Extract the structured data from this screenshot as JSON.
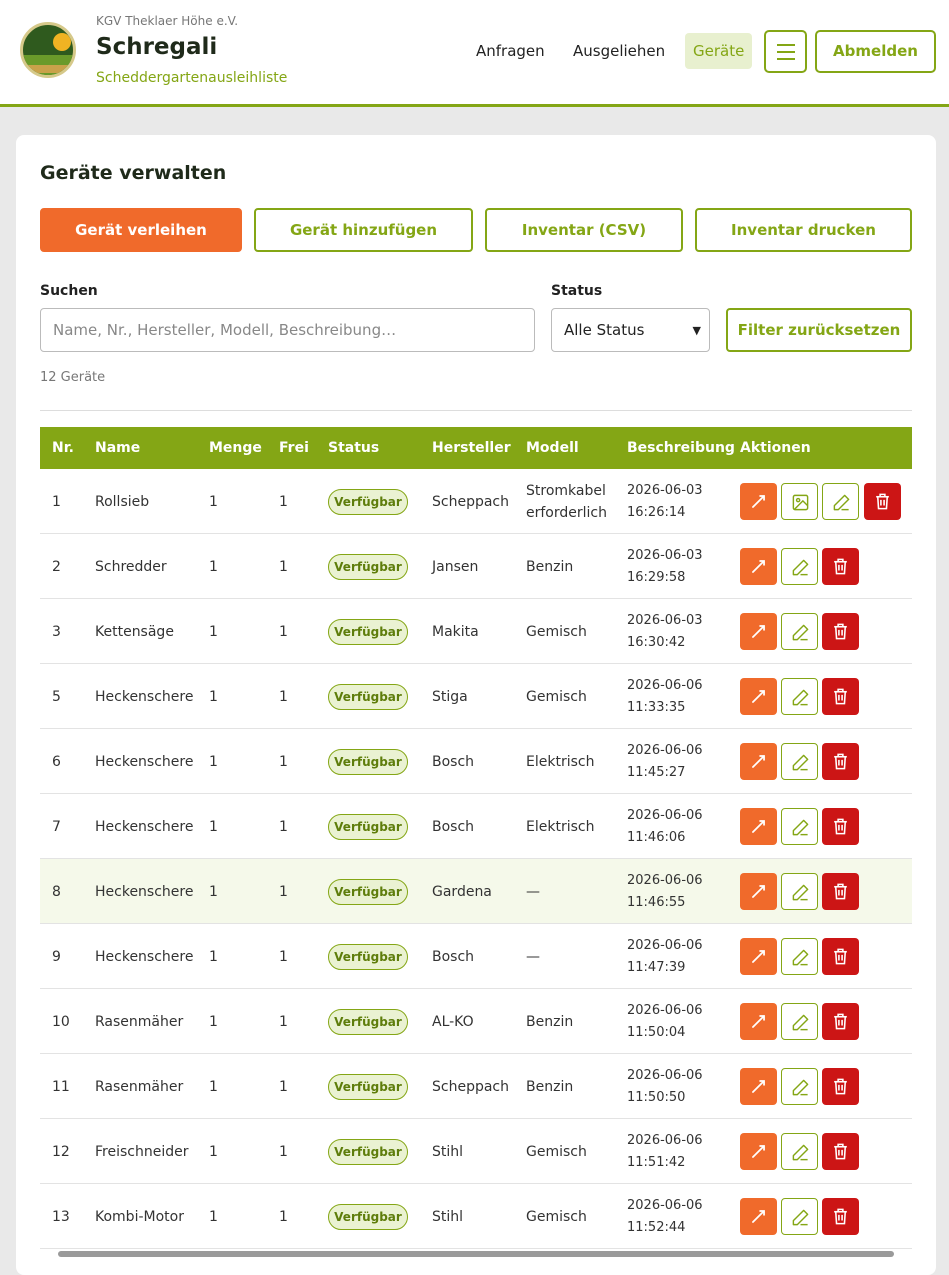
{
  "header": {
    "org": "KGV Theklaer Höhe e.V.",
    "title": "Schregali",
    "subtitle": "Scheddergartenausleihliste",
    "nav": [
      {
        "label": "Anfragen"
      },
      {
        "label": "Ausgeliehen"
      },
      {
        "label": "Geräte",
        "active": true
      }
    ],
    "logout_label": "Abmelden",
    "menu_icon": "hamburger-icon"
  },
  "main": {
    "title": "Geräte verwalten",
    "buttons": {
      "lend": "Gerät verleihen",
      "add": "Gerät hinzufügen",
      "csv": "Inventar (CSV)",
      "print": "Inventar drucken"
    },
    "search": {
      "label": "Suchen",
      "placeholder": "Name, Nr., Hersteller, Modell, Beschreibung…",
      "value": ""
    },
    "status_filter": {
      "label": "Status",
      "selected": "Alle Status"
    },
    "reset_label": "Filter zurücksetzen",
    "count": "12 Geräte"
  },
  "table": {
    "columns": [
      "Nr.",
      "Name",
      "Menge",
      "Frei",
      "Status",
      "Hersteller",
      "Modell",
      "Beschreibung",
      "Aktionen"
    ],
    "rows": [
      {
        "nr": "1",
        "name": "Rollsieb",
        "menge": "1",
        "frei": "1",
        "status": "Verfügbar",
        "hersteller": "Scheppach",
        "modell": "Stromkabel erforderlich",
        "date": "2026-06-03",
        "time": "16:26:14",
        "has_image": true
      },
      {
        "nr": "2",
        "name": "Schredder",
        "menge": "1",
        "frei": "1",
        "status": "Verfügbar",
        "hersteller": "Jansen",
        "modell": "Benzin",
        "date": "2026-06-03",
        "time": "16:29:58"
      },
      {
        "nr": "3",
        "name": "Kettensäge",
        "menge": "1",
        "frei": "1",
        "status": "Verfügbar",
        "hersteller": "Makita",
        "modell": "Gemisch",
        "date": "2026-06-03",
        "time": "16:30:42"
      },
      {
        "nr": "5",
        "name": "Heckenschere",
        "menge": "1",
        "frei": "1",
        "status": "Verfügbar",
        "hersteller": "Stiga",
        "modell": "Gemisch",
        "date": "2026-06-06",
        "time": "11:33:35"
      },
      {
        "nr": "6",
        "name": "Heckenschere",
        "menge": "1",
        "frei": "1",
        "status": "Verfügbar",
        "hersteller": "Bosch",
        "modell": "Elektrisch",
        "date": "2026-06-06",
        "time": "11:45:27"
      },
      {
        "nr": "7",
        "name": "Heckenschere",
        "menge": "1",
        "frei": "1",
        "status": "Verfügbar",
        "hersteller": "Bosch",
        "modell": "Elektrisch",
        "date": "2026-06-06",
        "time": "11:46:06"
      },
      {
        "nr": "8",
        "name": "Heckenschere",
        "menge": "1",
        "frei": "1",
        "status": "Verfügbar",
        "hersteller": "Gardena",
        "modell": "—",
        "date": "2026-06-06",
        "time": "11:46:55",
        "highlighted": true
      },
      {
        "nr": "9",
        "name": "Heckenschere",
        "menge": "1",
        "frei": "1",
        "status": "Verfügbar",
        "hersteller": "Bosch",
        "modell": "—",
        "date": "2026-06-06",
        "time": "11:47:39"
      },
      {
        "nr": "10",
        "name": "Rasenmäher",
        "menge": "1",
        "frei": "1",
        "status": "Verfügbar",
        "hersteller": "AL-KO",
        "modell": "Benzin",
        "date": "2026-06-06",
        "time": "11:50:04"
      },
      {
        "nr": "11",
        "name": "Rasenmäher",
        "menge": "1",
        "frei": "1",
        "status": "Verfügbar",
        "hersteller": "Scheppach",
        "modell": "Benzin",
        "date": "2026-06-06",
        "time": "11:50:50"
      },
      {
        "nr": "12",
        "name": "Freischneider",
        "menge": "1",
        "frei": "1",
        "status": "Verfügbar",
        "hersteller": "Stihl",
        "modell": "Gemisch",
        "date": "2026-06-06",
        "time": "11:51:42"
      },
      {
        "nr": "13",
        "name": "Kombi-Motor",
        "menge": "1",
        "frei": "1",
        "status": "Verfügbar",
        "hersteller": "Stihl",
        "modell": "Gemisch",
        "date": "2026-06-06",
        "time": "11:52:44"
      }
    ]
  },
  "colors": {
    "accent": "#84a615",
    "primary": "#f06a2b",
    "danger": "#cc1515",
    "badge_bg": "#eaf2d2"
  }
}
